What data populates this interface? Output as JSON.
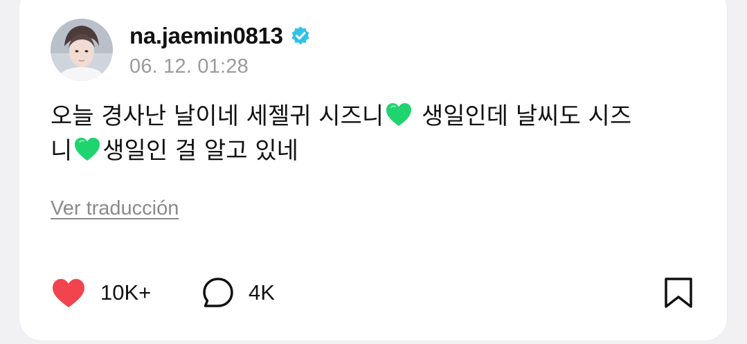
{
  "post": {
    "author": {
      "username": "na.jaemin0813",
      "verified": true,
      "verified_color": "#2fc3ea"
    },
    "timestamp": "06. 12. 01:28",
    "text_lines": [
      {
        "before": "오늘 경사난 날이네 세젤귀 시즈니",
        "emoji": "green-heart",
        "after": " 생일인데 날씨도 시즈"
      },
      {
        "before": "니",
        "emoji": "green-heart",
        "after": "생일인 걸 알고 있네"
      }
    ],
    "translate_label": "Ver traducción",
    "actions": {
      "likes": "10K+",
      "comments": "4K",
      "like_color": "#f1444f"
    },
    "emoji_color": "#1fd36f"
  }
}
